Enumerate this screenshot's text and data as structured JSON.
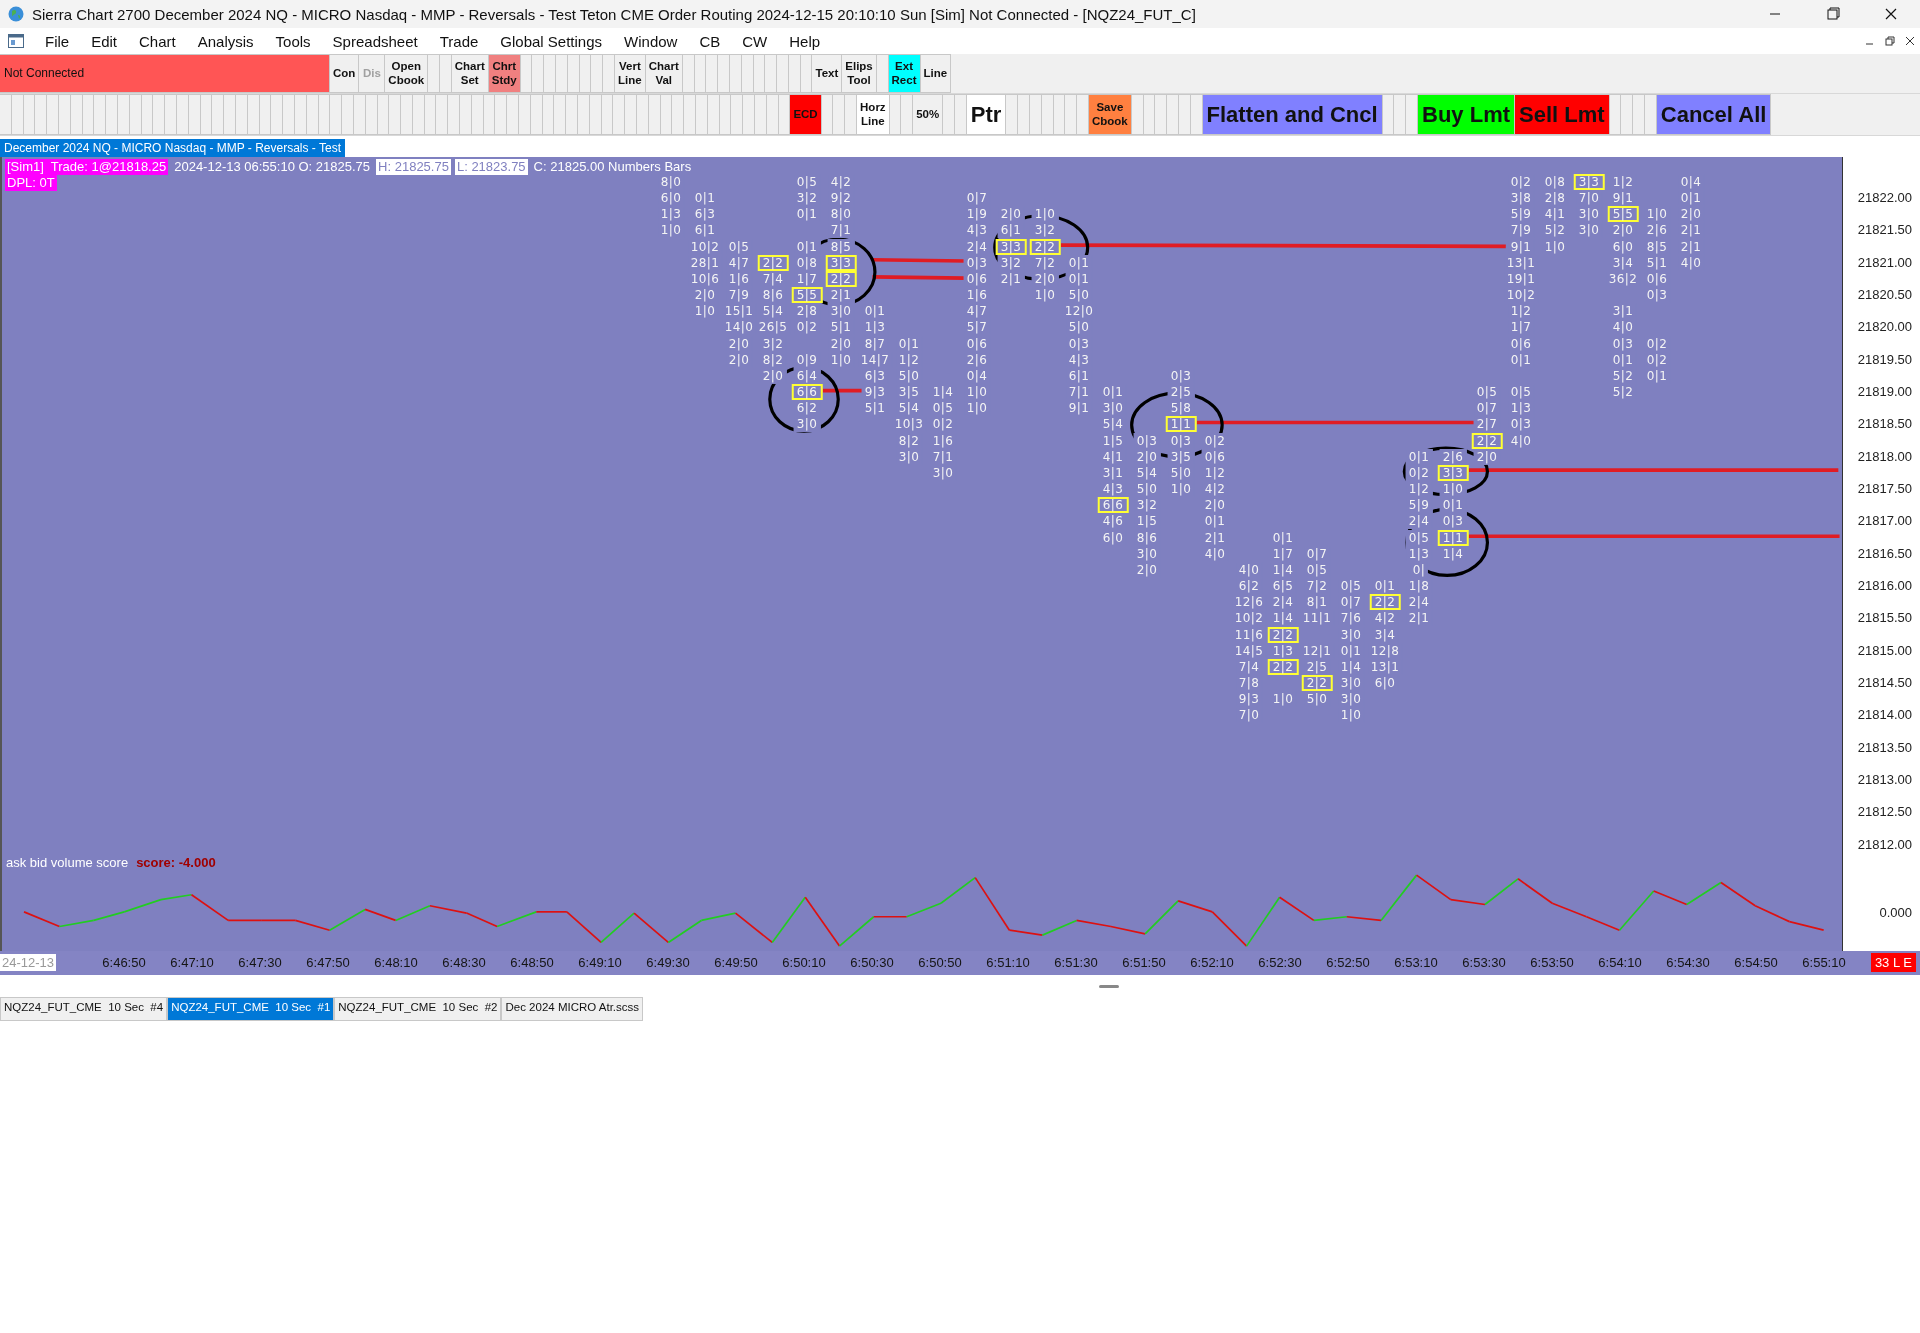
{
  "window": {
    "title": "Sierra Chart 2700 December 2024 NQ - MICRO Nasdaq - MMP - Reversals - Test Teton CME Order Routing 2024-12-15  20:10:10 Sun [Sim] Not Connected - [NQZ24_FUT_C]"
  },
  "menu": [
    "File",
    "Edit",
    "Chart",
    "Analysis",
    "Tools",
    "Spreadsheet",
    "Trade",
    "Global Settings",
    "Window",
    "CB",
    "CW",
    "Help"
  ],
  "toolbar_rows": [
    [
      {
        "kind": "status",
        "label": "Not Connected",
        "color": "#ff5555",
        "disabled": false
      },
      {
        "kind": "small",
        "label": "Con",
        "color": "#f0f0f0",
        "disabled": false
      },
      {
        "kind": "small",
        "label": "Dis",
        "color": "#f0f0f0",
        "disabled": true
      },
      {
        "kind": "small",
        "label": "Open Cbook",
        "color": "#f0f0f0",
        "disabled": false
      },
      {
        "kind": "small",
        "label": "Chart Set",
        "color": "#f0f0f0",
        "disabled": false
      },
      {
        "kind": "small",
        "label": "Chrt Stdy",
        "color": "#f08080",
        "disabled": false
      },
      {
        "kind": "small",
        "label": "Vert Line",
        "color": "#f0f0f0",
        "disabled": false
      },
      {
        "kind": "small",
        "label": "Chart Val",
        "color": "#f0f0f0",
        "disabled": false
      },
      {
        "kind": "small",
        "label": "Text",
        "color": "#f0f0f0",
        "disabled": false
      },
      {
        "kind": "small",
        "label": "Elips Tool",
        "color": "#f0f0f0",
        "disabled": false
      },
      {
        "kind": "small",
        "label": "Ext Rect",
        "color": "#00ffff",
        "disabled": false
      },
      {
        "kind": "small",
        "label": "Line",
        "color": "#f0f0f0",
        "disabled": false
      }
    ],
    [
      {
        "kind": "small",
        "label": "ECD",
        "color": "#ff0000",
        "disabled": false
      },
      {
        "kind": "small",
        "label": "Horz Line",
        "color": "#ffffff",
        "disabled": false
      },
      {
        "kind": "small",
        "label": "50%",
        "color": "#f0f0f0",
        "disabled": false
      },
      {
        "kind": "large",
        "label": "Ptr",
        "color": "#ffffff",
        "disabled": false
      },
      {
        "kind": "small",
        "label": "Save Cbook",
        "color": "#ff8040",
        "disabled": false
      },
      {
        "kind": "large",
        "label": "Flatten and Cncl",
        "color": "#8080ff",
        "disabled": false
      },
      {
        "kind": "large",
        "label": "Buy Lmt",
        "color": "#00ff00",
        "disabled": false
      },
      {
        "kind": "large",
        "label": "Sell Lmt",
        "color": "#ff0000",
        "disabled": false
      },
      {
        "kind": "large",
        "label": "Cancel All",
        "color": "#8080ff",
        "disabled": false
      }
    ]
  ],
  "chart_tab": {
    "label": "December 2024 NQ - MICRO Nasdaq - MMP - Reversals - Test"
  },
  "chart": {
    "header": [
      [
        {
          "kind": "highlight",
          "text": "[Sim1]  Trade: 1@21818.25"
        },
        {
          "kind": "plain",
          "text": "2024-12-13 06:55:10 O: 21825.75"
        },
        {
          "kind": "boxed",
          "text": "H: 21825.75"
        },
        {
          "kind": "boxed",
          "text": "L: 21823.75"
        },
        {
          "kind": "plain",
          "text": "C: 21825.00 Numbers Bars"
        }
      ],
      [
        {
          "kind": "highlight",
          "text": "DPL: 0T"
        }
      ]
    ],
    "bars": [
      {
        "cells": [
          {
            "text": "8|0",
            "highlighted": false
          },
          {
            "text": "6|0",
            "highlighted": false
          },
          {
            "text": "1|3",
            "highlighted": false
          },
          {
            "text": "1|0",
            "highlighted": false
          }
        ]
      },
      {
        "cells": [
          null,
          {
            "text": "0|1",
            "highlighted": false
          },
          {
            "text": "6|3",
            "highlighted": false
          },
          {
            "text": "6|1",
            "highlighted": false
          },
          {
            "text": "10|2",
            "highlighted": false
          },
          {
            "text": "28|1",
            "highlighted": false
          },
          {
            "text": "10|6",
            "highlighted": false
          },
          {
            "text": "2|0",
            "highlighted": false
          },
          {
            "text": "1|0",
            "highlighted": false
          }
        ]
      },
      {
        "cells": [
          null,
          null,
          null,
          null,
          {
            "text": "0|5",
            "highlighted": false
          },
          {
            "text": "4|7",
            "highlighted": false
          },
          {
            "text": "1|6",
            "highlighted": false
          },
          {
            "text": "7|9",
            "highlighted": false
          },
          {
            "text": "15|1",
            "highlighted": false
          },
          {
            "text": "14|0",
            "highlighted": false
          },
          {
            "text": "2|0",
            "highlighted": false
          },
          {
            "text": "2|0",
            "highlighted": false
          }
        ]
      },
      {
        "cells": [
          null,
          null,
          null,
          null,
          null,
          {
            "text": "2|2",
            "highlighted": true
          },
          {
            "text": "7|4",
            "highlighted": false
          },
          {
            "text": "8|6",
            "highlighted": false
          },
          {
            "text": "5|4",
            "highlighted": false
          },
          {
            "text": "26|5",
            "highlighted": false
          },
          {
            "text": "3|2",
            "highlighted": false
          },
          {
            "text": "8|2",
            "highlighted": false
          },
          {
            "text": "2|0",
            "highlighted": false
          }
        ]
      },
      {
        "cells": [
          {
            "text": "0|5",
            "highlighted": false
          },
          {
            "text": "3|2",
            "highlighted": false
          },
          {
            "text": "0|1",
            "highlighted": false
          },
          null,
          {
            "text": "0|1",
            "highlighted": false
          },
          {
            "text": "0|8",
            "highlighted": false
          },
          {
            "text": "1|7",
            "highlighted": false
          },
          {
            "text": "5|5",
            "highlighted": true
          },
          {
            "text": "2|8",
            "highlighted": false
          },
          {
            "text": "0|2",
            "highlighted": false
          },
          null,
          {
            "text": "0|9",
            "highlighted": false
          },
          {
            "text": "6|4",
            "highlighted": false
          },
          {
            "text": "6|6",
            "highlighted": true
          },
          {
            "text": "6|2",
            "highlighted": false
          },
          {
            "text": "3|0",
            "highlighted": false
          }
        ]
      },
      {
        "cells": [
          {
            "text": "4|2",
            "highlighted": false
          },
          {
            "text": "9|2",
            "highlighted": false
          },
          {
            "text": "8|0",
            "highlighted": false
          },
          {
            "text": "7|1",
            "highlighted": false
          },
          {
            "text": "8|5",
            "highlighted": false
          },
          {
            "text": "3|3",
            "highlighted": true
          },
          {
            "text": "2|2",
            "highlighted": true
          },
          {
            "text": "2|1",
            "highlighted": false
          },
          {
            "text": "3|0",
            "highlighted": false
          },
          {
            "text": "5|1",
            "highlighted": false
          },
          {
            "text": "2|0",
            "highlighted": false
          },
          {
            "text": "1|0",
            "highlighted": false
          }
        ]
      },
      {
        "cells": [
          null,
          null,
          null,
          null,
          null,
          null,
          null,
          null,
          {
            "text": "0|1",
            "highlighted": false
          },
          {
            "text": "1|3",
            "highlighted": false
          },
          {
            "text": "8|7",
            "highlighted": false
          },
          {
            "text": "14|7",
            "highlighted": false
          },
          {
            "text": "6|3",
            "highlighted": false
          },
          {
            "text": "9|3",
            "highlighted": false
          },
          {
            "text": "5|1",
            "highlighted": false
          }
        ]
      },
      {
        "cells": [
          null,
          null,
          null,
          null,
          null,
          null,
          null,
          null,
          null,
          null,
          {
            "text": "0|1",
            "highlighted": false
          },
          {
            "text": "1|2",
            "highlighted": false
          },
          {
            "text": "5|0",
            "highlighted": false
          },
          {
            "text": "3|5",
            "highlighted": false
          },
          {
            "text": "5|4",
            "highlighted": false
          },
          {
            "text": "10|3",
            "highlighted": false
          },
          {
            "text": "8|2",
            "highlighted": false
          },
          {
            "text": "3|0",
            "highlighted": false
          }
        ]
      },
      {
        "cells": [
          null,
          null,
          null,
          null,
          null,
          null,
          null,
          null,
          null,
          null,
          null,
          null,
          null,
          {
            "text": "1|4",
            "highlighted": false
          },
          {
            "text": "0|5",
            "highlighted": false
          },
          {
            "text": "0|2",
            "highlighted": false
          },
          {
            "text": "1|6",
            "highlighted": false
          },
          {
            "text": "7|1",
            "highlighted": false
          },
          {
            "text": "3|0",
            "highlighted": false
          }
        ]
      },
      {
        "cells": [
          null,
          {
            "text": "0|7",
            "highlighted": false
          },
          {
            "text": "1|9",
            "highlighted": false
          },
          {
            "text": "4|3",
            "highlighted": false
          },
          {
            "text": "2|4",
            "highlighted": false
          },
          {
            "text": "0|3",
            "highlighted": false
          },
          {
            "text": "0|6",
            "highlighted": false
          },
          {
            "text": "1|6",
            "highlighted": false
          },
          {
            "text": "4|7",
            "highlighted": false
          },
          {
            "text": "5|7",
            "highlighted": false
          },
          {
            "text": "0|6",
            "highlighted": false
          },
          {
            "text": "2|6",
            "highlighted": false
          },
          {
            "text": "0|4",
            "highlighted": false
          },
          {
            "text": "1|0",
            "highlighted": false
          },
          {
            "text": "1|0",
            "highlighted": false
          }
        ]
      },
      {
        "cells": [
          null,
          null,
          {
            "text": "2|0",
            "highlighted": false
          },
          {
            "text": "6|1",
            "highlighted": false
          },
          {
            "text": "3|3",
            "highlighted": true
          },
          {
            "text": "3|2",
            "highlighted": false
          },
          {
            "text": "2|1",
            "highlighted": false
          }
        ]
      },
      {
        "cells": [
          null,
          null,
          {
            "text": "1|0",
            "highlighted": false
          },
          {
            "text": "3|2",
            "highlighted": false
          },
          {
            "text": "2|2",
            "highlighted": true
          },
          {
            "text": "7|2",
            "highlighted": false
          },
          {
            "text": "2|0",
            "highlighted": false
          },
          {
            "text": "1|0",
            "highlighted": false
          }
        ]
      },
      {
        "cells": [
          null,
          null,
          null,
          null,
          null,
          {
            "text": "0|1",
            "highlighted": false
          },
          {
            "text": "0|1",
            "highlighted": false
          },
          {
            "text": "5|0",
            "highlighted": false
          },
          {
            "text": "12|0",
            "highlighted": false
          },
          {
            "text": "5|0",
            "highlighted": false
          },
          {
            "text": "0|3",
            "highlighted": false
          },
          {
            "text": "4|3",
            "highlighted": false
          },
          {
            "text": "6|1",
            "highlighted": false
          },
          {
            "text": "7|1",
            "highlighted": false
          },
          {
            "text": "9|1",
            "highlighted": false
          }
        ]
      },
      {
        "cells": [
          null,
          null,
          null,
          null,
          null,
          null,
          null,
          null,
          null,
          null,
          null,
          null,
          null,
          {
            "text": "0|1",
            "highlighted": false
          },
          {
            "text": "3|0",
            "highlighted": false
          },
          {
            "text": "5|4",
            "highlighted": false
          },
          {
            "text": "1|5",
            "highlighted": false
          },
          {
            "text": "4|1",
            "highlighted": false
          },
          {
            "text": "3|1",
            "highlighted": false
          },
          {
            "text": "4|3",
            "highlighted": false
          },
          {
            "text": "6|6",
            "highlighted": true
          },
          {
            "text": "4|6",
            "highlighted": false
          },
          {
            "text": "6|0",
            "highlighted": false
          }
        ]
      },
      {
        "cells": [
          null,
          null,
          null,
          null,
          null,
          null,
          null,
          null,
          null,
          null,
          null,
          null,
          null,
          null,
          null,
          null,
          {
            "text": "0|3",
            "highlighted": false
          },
          {
            "text": "2|0",
            "highlighted": false
          },
          {
            "text": "5|4",
            "highlighted": false
          },
          {
            "text": "5|0",
            "highlighted": false
          },
          {
            "text": "3|2",
            "highlighted": false
          },
          {
            "text": "1|5",
            "highlighted": false
          },
          {
            "text": "8|6",
            "highlighted": false
          },
          {
            "text": "3|0",
            "highlighted": false
          },
          {
            "text": "2|0",
            "highlighted": false
          }
        ]
      },
      {
        "cells": [
          null,
          null,
          null,
          null,
          null,
          null,
          null,
          null,
          null,
          null,
          null,
          null,
          {
            "text": "0|3",
            "highlighted": false
          },
          {
            "text": "2|5",
            "highlighted": false
          },
          {
            "text": "5|8",
            "highlighted": false
          },
          {
            "text": "1|1",
            "highlighted": true
          },
          {
            "text": "0|3",
            "highlighted": false
          },
          {
            "text": "3|5",
            "highlighted": false
          },
          {
            "text": "5|0",
            "highlighted": false
          },
          {
            "text": "1|0",
            "highlighted": false
          }
        ]
      },
      {
        "cells": [
          null,
          null,
          null,
          null,
          null,
          null,
          null,
          null,
          null,
          null,
          null,
          null,
          null,
          null,
          null,
          null,
          {
            "text": "0|2",
            "highlighted": false
          },
          {
            "text": "0|6",
            "highlighted": false
          },
          {
            "text": "1|2",
            "highlighted": false
          },
          {
            "text": "4|2",
            "highlighted": false
          },
          {
            "text": "2|0",
            "highlighted": false
          },
          {
            "text": "0|1",
            "highlighted": false
          },
          {
            "text": "2|1",
            "highlighted": false
          },
          {
            "text": "4|0",
            "highlighted": false
          }
        ]
      },
      {
        "cells": [
          null,
          null,
          null,
          null,
          null,
          null,
          null,
          null,
          null,
          null,
          null,
          null,
          null,
          null,
          null,
          null,
          null,
          null,
          null,
          null,
          null,
          null,
          null,
          null,
          {
            "text": "4|0",
            "highlighted": false
          },
          {
            "text": "6|2",
            "highlighted": false
          },
          {
            "text": "12|6",
            "highlighted": false
          },
          {
            "text": "10|2",
            "highlighted": false
          },
          {
            "text": "11|6",
            "highlighted": false
          },
          {
            "text": "14|5",
            "highlighted": false
          },
          {
            "text": "7|4",
            "highlighted": false
          },
          {
            "text": "7|8",
            "highlighted": false
          },
          {
            "text": "9|3",
            "highlighted": false
          },
          {
            "text": "7|0",
            "highlighted": false
          }
        ]
      },
      {
        "cells": [
          null,
          null,
          null,
          null,
          null,
          null,
          null,
          null,
          null,
          null,
          null,
          null,
          null,
          null,
          null,
          null,
          null,
          null,
          null,
          null,
          null,
          null,
          {
            "text": "0|1",
            "highlighted": false
          },
          {
            "text": "1|7",
            "highlighted": false
          },
          {
            "text": "1|4",
            "highlighted": false
          },
          {
            "text": "6|5",
            "highlighted": false
          },
          {
            "text": "2|4",
            "highlighted": false
          },
          {
            "text": "1|4",
            "highlighted": false
          },
          {
            "text": "2|2",
            "highlighted": true
          },
          {
            "text": "1|3",
            "highlighted": false
          },
          {
            "text": "2|2",
            "highlighted": true
          },
          null,
          {
            "text": "1|0",
            "highlighted": false
          }
        ]
      },
      {
        "cells": [
          null,
          null,
          null,
          null,
          null,
          null,
          null,
          null,
          null,
          null,
          null,
          null,
          null,
          null,
          null,
          null,
          null,
          null,
          null,
          null,
          null,
          null,
          null,
          {
            "text": "0|7",
            "highlighted": false
          },
          {
            "text": "0|5",
            "highlighted": false
          },
          {
            "text": "7|2",
            "highlighted": false
          },
          {
            "text": "8|1",
            "highlighted": false
          },
          {
            "text": "11|1",
            "highlighted": false
          },
          null,
          {
            "text": "12|1",
            "highlighted": false
          },
          {
            "text": "2|5",
            "highlighted": false
          },
          {
            "text": "2|2",
            "highlighted": true
          },
          {
            "text": "5|0",
            "highlighted": false
          }
        ]
      },
      {
        "cells": [
          null,
          null,
          null,
          null,
          null,
          null,
          null,
          null,
          null,
          null,
          null,
          null,
          null,
          null,
          null,
          null,
          null,
          null,
          null,
          null,
          null,
          null,
          null,
          null,
          null,
          {
            "text": "0|5",
            "highlighted": false
          },
          {
            "text": "0|7",
            "highlighted": false
          },
          {
            "text": "7|6",
            "highlighted": false
          },
          {
            "text": "3|0",
            "highlighted": false
          },
          {
            "text": "0|1",
            "highlighted": false
          },
          {
            "text": "1|4",
            "highlighted": false
          },
          {
            "text": "3|0",
            "highlighted": false
          },
          {
            "text": "3|0",
            "highlighted": false
          },
          {
            "text": "1|0",
            "highlighted": false
          }
        ]
      },
      {
        "cells": [
          null,
          null,
          null,
          null,
          null,
          null,
          null,
          null,
          null,
          null,
          null,
          null,
          null,
          null,
          null,
          null,
          null,
          null,
          null,
          null,
          null,
          null,
          null,
          null,
          null,
          {
            "text": "0|1",
            "highlighted": false
          },
          {
            "text": "2|2",
            "highlighted": true
          },
          {
            "text": "4|2",
            "highlighted": false
          },
          {
            "text": "3|4",
            "highlighted": false
          },
          {
            "text": "12|8",
            "highlighted": false
          },
          {
            "text": "13|1",
            "highlighted": false
          },
          {
            "text": "6|0",
            "highlighted": false
          }
        ]
      },
      {
        "cells": [
          null,
          null,
          null,
          null,
          null,
          null,
          null,
          null,
          null,
          null,
          null,
          null,
          null,
          null,
          null,
          null,
          null,
          {
            "text": "0|1",
            "highlighted": false
          },
          {
            "text": "0|2",
            "highlighted": false
          },
          {
            "text": "1|2",
            "highlighted": false
          },
          {
            "text": "5|9",
            "highlighted": false
          },
          {
            "text": "2|4",
            "highlighted": false
          },
          {
            "text": "0|5",
            "highlighted": false
          },
          {
            "text": "1|3",
            "highlighted": false
          },
          {
            "text": "0|",
            "highlighted": false
          },
          {
            "text": "1|8",
            "highlighted": false
          },
          {
            "text": "2|4",
            "highlighted": false
          },
          {
            "text": "2|1",
            "highlighted": false
          }
        ]
      },
      {
        "cells": [
          null,
          null,
          null,
          null,
          null,
          null,
          null,
          null,
          null,
          null,
          null,
          null,
          null,
          null,
          null,
          null,
          null,
          {
            "text": "2|6",
            "highlighted": false
          },
          {
            "text": "3|3",
            "highlighted": true
          },
          {
            "text": "1|0",
            "highlighted": false
          },
          {
            "text": "0|1",
            "highlighted": false
          },
          {
            "text": "0|3",
            "highlighted": false
          },
          {
            "text": "1|1",
            "highlighted": true
          },
          {
            "text": "1|4",
            "highlighted": false
          }
        ]
      },
      {
        "cells": [
          null,
          null,
          null,
          null,
          null,
          null,
          null,
          null,
          null,
          null,
          null,
          null,
          null,
          {
            "text": "0|5",
            "highlighted": false
          },
          {
            "text": "0|7",
            "highlighted": false
          },
          {
            "text": "2|7",
            "highlighted": false
          },
          {
            "text": "2|2",
            "highlighted": true
          },
          {
            "text": "2|0",
            "highlighted": false
          }
        ]
      },
      {
        "cells": [
          {
            "text": "0|2",
            "highlighted": false
          },
          {
            "text": "3|8",
            "highlighted": false
          },
          {
            "text": "5|9",
            "highlighted": false
          },
          {
            "text": "7|9",
            "highlighted": false
          },
          {
            "text": "9|1",
            "highlighted": false
          },
          {
            "text": "13|1",
            "highlighted": false
          },
          {
            "text": "19|1",
            "highlighted": false
          },
          {
            "text": "10|2",
            "highlighted": false
          },
          {
            "text": "1|2",
            "highlighted": false
          },
          {
            "text": "1|7",
            "highlighted": false
          },
          {
            "text": "0|6",
            "highlighted": false
          },
          {
            "text": "0|1",
            "highlighted": false
          },
          null,
          {
            "text": "0|5",
            "highlighted": false
          },
          {
            "text": "1|3",
            "highlighted": false
          },
          {
            "text": "0|3",
            "highlighted": false
          },
          {
            "text": "4|0",
            "highlighted": false
          }
        ]
      },
      {
        "cells": [
          {
            "text": "0|8",
            "highlighted": false
          },
          {
            "text": "2|8",
            "highlighted": false
          },
          {
            "text": "4|1",
            "highlighted": false
          },
          {
            "text": "5|2",
            "highlighted": false
          },
          {
            "text": "1|0",
            "highlighted": false
          }
        ]
      },
      {
        "cells": [
          {
            "text": "3|3",
            "highlighted": true
          },
          {
            "text": "7|0",
            "highlighted": false
          },
          {
            "text": "3|0",
            "highlighted": false
          },
          {
            "text": "3|0",
            "highlighted": false
          }
        ]
      },
      {
        "cells": [
          {
            "text": "1|2",
            "highlighted": false
          },
          {
            "text": "9|1",
            "highlighted": false
          },
          {
            "text": "5|5",
            "highlighted": true
          },
          {
            "text": "2|0",
            "highlighted": false
          },
          {
            "text": "6|0",
            "highlighted": false
          },
          {
            "text": "3|4",
            "highlighted": false
          },
          {
            "text": "36|2",
            "highlighted": false
          },
          null,
          {
            "text": "3|1",
            "highlighted": false
          },
          {
            "text": "4|0",
            "highlighted": false
          },
          {
            "text": "0|3",
            "highlighted": false
          },
          {
            "text": "0|1",
            "highlighted": false
          },
          {
            "text": "5|2",
            "highlighted": false
          },
          {
            "text": "5|2",
            "highlighted": false
          }
        ]
      },
      {
        "cells": [
          null,
          null,
          {
            "text": "1|0",
            "highlighted": false
          },
          {
            "text": "2|6",
            "highlighted": false
          },
          {
            "text": "8|5",
            "highlighted": false
          },
          {
            "text": "5|1",
            "highlighted": false
          },
          {
            "text": "0|6",
            "highlighted": false
          },
          {
            "text": "0|3",
            "highlighted": false
          },
          null,
          null,
          {
            "text": "0|2",
            "highlighted": false
          },
          {
            "text": "0|2",
            "highlighted": false
          },
          {
            "text": "0|1",
            "highlighted": false
          }
        ]
      },
      {
        "cells": [
          {
            "text": "0|4",
            "highlighted": false
          },
          {
            "text": "0|1",
            "highlighted": false
          },
          {
            "text": "2|0",
            "highlighted": false
          },
          {
            "text": "2|1",
            "highlighted": false
          },
          {
            "text": "2|1",
            "highlighted": false
          },
          {
            "text": "4|0",
            "highlighted": false
          }
        ]
      }
    ],
    "price_axis": [
      "21822.00",
      "21821.50",
      "21821.00",
      "21820.50",
      "21820.00",
      "21819.50",
      "21819.00",
      "21818.50",
      "21818.00",
      "21817.50",
      "21817.00",
      "21816.50",
      "21816.00",
      "21815.50",
      "21815.00",
      "21814.50",
      "21814.00",
      "21813.50",
      "21813.00",
      "21812.50",
      "21812.00"
    ],
    "indicator": {
      "name": "ask bid volume score",
      "score": "score: -4.000",
      "axis_label": "0.000"
    },
    "time_axis": {
      "date": "24-12-13",
      "labels": [
        "6:46:50",
        "6:47:10",
        "6:47:30",
        "6:47:50",
        "6:48:10",
        "6:48:30",
        "6:48:50",
        "6:49:10",
        "6:49:30",
        "6:49:50",
        "6:50:10",
        "6:50:30",
        "6:50:50",
        "6:51:10",
        "6:51:30",
        "6:51:50",
        "6:52:10",
        "6:52:30",
        "6:52:50",
        "6:53:10",
        "6:53:30",
        "6:53:50",
        "6:54:10",
        "6:54:30",
        "6:54:50",
        "6:55:10"
      ],
      "badge": "33 L E"
    }
  },
  "bottom_tabs": [
    {
      "label": "NQZ24_FUT_CME  10 Sec  #4",
      "selected": false
    },
    {
      "label": "NQZ24_FUT_CME  10 Sec  #1",
      "selected": true
    },
    {
      "label": "NQZ24_FUT_CME  10 Sec  #2",
      "selected": false
    },
    {
      "label": "Dec 2024 MICRO Atr.scss",
      "selected": false
    }
  ]
}
